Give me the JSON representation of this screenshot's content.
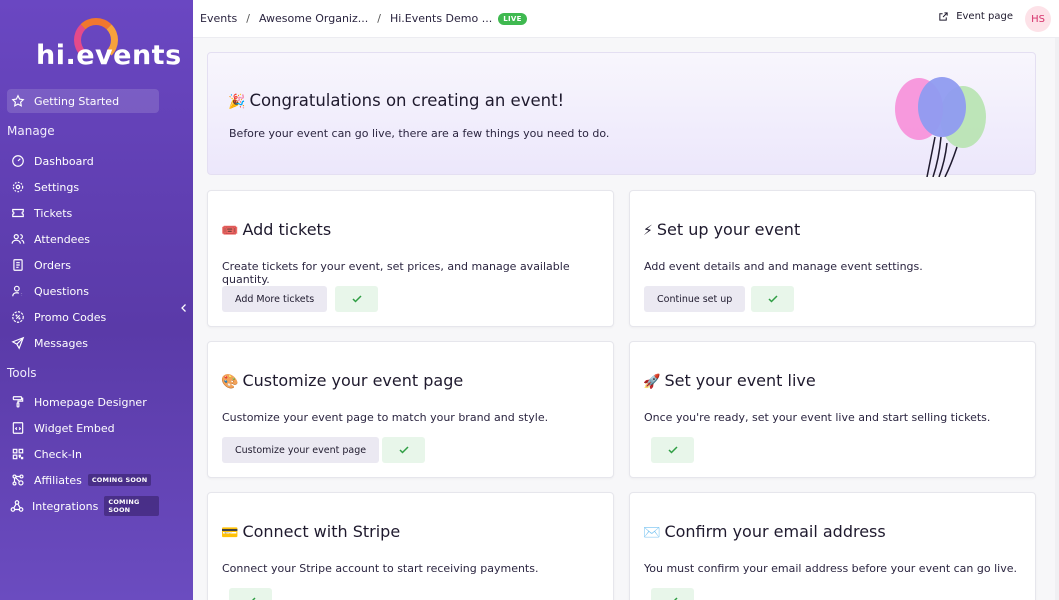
{
  "app": {
    "logo_text": "hi.events"
  },
  "sidebar": {
    "getting_started": "Getting Started",
    "manage_title": "Manage",
    "manage_items": [
      {
        "label": "Dashboard",
        "icon": "dashboard-icon"
      },
      {
        "label": "Settings",
        "icon": "gear-icon"
      },
      {
        "label": "Tickets",
        "icon": "ticket-icon"
      },
      {
        "label": "Attendees",
        "icon": "users-icon"
      },
      {
        "label": "Orders",
        "icon": "receipt-icon"
      },
      {
        "label": "Questions",
        "icon": "question-user-icon"
      },
      {
        "label": "Promo Codes",
        "icon": "discount-icon"
      },
      {
        "label": "Messages",
        "icon": "send-icon"
      }
    ],
    "tools_title": "Tools",
    "tools_items": [
      {
        "label": "Homepage Designer",
        "icon": "paint-roller-icon"
      },
      {
        "label": "Widget Embed",
        "icon": "embed-icon"
      },
      {
        "label": "Check-In",
        "icon": "qr-code-icon"
      },
      {
        "label": "Affiliates",
        "icon": "affiliate-icon",
        "badge": "COMING SOON"
      },
      {
        "label": "Integrations",
        "icon": "webhook-icon",
        "badge": "COMING SOON"
      }
    ]
  },
  "header": {
    "breadcrumbs": [
      "Events",
      "Awesome Organiz...",
      "Hi.Events Demo ..."
    ],
    "status_badge": "LIVE",
    "event_page_label": "Event page",
    "avatar_initials": "HS"
  },
  "banner": {
    "emoji": "🎉",
    "title": "Congratulations on creating an event!",
    "subtitle": "Before your event can go live, there are a few things you need to do."
  },
  "cards": [
    {
      "emoji": "🎟️",
      "title": "Add tickets",
      "desc": "Create tickets for your event, set prices, and manage available quantity.",
      "button": "Add More tickets",
      "done": true
    },
    {
      "emoji": "⚡",
      "title": "Set up your event",
      "desc": "Add event details and and manage event settings.",
      "button": "Continue set up",
      "done": true
    },
    {
      "emoji": "🎨",
      "title": "Customize your event page",
      "desc": "Customize your event page to match your brand and style.",
      "button": "Customize your event page",
      "done": true
    },
    {
      "emoji": "🚀",
      "title": "Set your event live",
      "desc": "Once you're ready, set your event live and start selling tickets.",
      "button": "",
      "done": true
    },
    {
      "emoji": "💳",
      "title": "Connect with Stripe",
      "desc": "Connect your Stripe account to start receiving payments.",
      "button": "",
      "done": true
    },
    {
      "emoji": "✉️",
      "title": "Confirm your email address",
      "desc": "You must confirm your email address before your event can go live.",
      "button": "",
      "done": true
    }
  ],
  "colors": {
    "sidebar": "#5f3fb0",
    "live": "#3fb950",
    "check": "#2f9e44",
    "accent": "#6a47c2"
  }
}
